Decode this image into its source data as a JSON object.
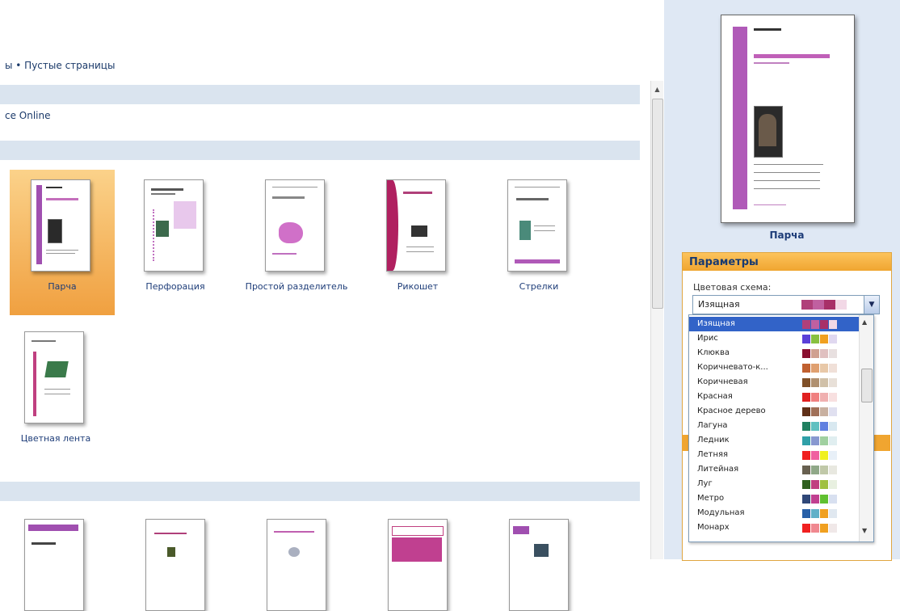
{
  "breadcrumb": "ы • Пустые страницы",
  "online_label": "ce Online",
  "templates": [
    {
      "label": "Парча",
      "selected": true
    },
    {
      "label": "Перфорация",
      "selected": false
    },
    {
      "label": "Простой разделитель",
      "selected": false
    },
    {
      "label": "Рикошет",
      "selected": false
    },
    {
      "label": "Стрелки",
      "selected": false
    },
    {
      "label": "Цветная лента",
      "selected": false
    }
  ],
  "preview": {
    "label": "Парча"
  },
  "params": {
    "title": "Параметры",
    "color_scheme_label": "Цветовая схема:",
    "selected_scheme": "Изящная",
    "selected_colors": [
      "#b0407a",
      "#c060a0",
      "#a83068",
      "#f2d8e6"
    ]
  },
  "scheme_options": [
    {
      "name": "Изящная",
      "colors": [
        "#b0407a",
        "#c060a0",
        "#a83068",
        "#f2d8e6"
      ],
      "highlighted": true
    },
    {
      "name": "Ирис",
      "colors": [
        "#5a40d8",
        "#88c040",
        "#f0a020",
        "#e0d8f0"
      ]
    },
    {
      "name": "Клюква",
      "colors": [
        "#8a1030",
        "#d0a090",
        "#e0c0c0",
        "#e8e0e0"
      ]
    },
    {
      "name": "Коричневато-к...",
      "colors": [
        "#c06030",
        "#e0a070",
        "#e8c8a8",
        "#f0e0d8"
      ]
    },
    {
      "name": "Коричневая",
      "colors": [
        "#805028",
        "#b09070",
        "#d0c0a8",
        "#e8e0d8"
      ]
    },
    {
      "name": "Красная",
      "colors": [
        "#e02020",
        "#f08080",
        "#f0b0b0",
        "#f8e0e0"
      ]
    },
    {
      "name": "Красное дерево",
      "colors": [
        "#603018",
        "#a07058",
        "#c8b0a0",
        "#e0e0f0"
      ]
    },
    {
      "name": "Лагуна",
      "colors": [
        "#208060",
        "#60c0c0",
        "#6080e0",
        "#d8e8f0"
      ]
    },
    {
      "name": "Ледник",
      "colors": [
        "#30a0a8",
        "#8898d0",
        "#a0d0a0",
        "#e0eef0"
      ]
    },
    {
      "name": "Летняя",
      "colors": [
        "#f02020",
        "#f060a0",
        "#f0f020",
        "#e8f0f8"
      ]
    },
    {
      "name": "Литейная",
      "colors": [
        "#686050",
        "#90a888",
        "#c0c8a8",
        "#e8e8e0"
      ]
    },
    {
      "name": "Луг",
      "colors": [
        "#306020",
        "#c04080",
        "#a0c040",
        "#e8f0e0"
      ]
    },
    {
      "name": "Метро",
      "colors": [
        "#304878",
        "#c04090",
        "#60c030",
        "#d8e0f0"
      ]
    },
    {
      "name": "Модульная",
      "colors": [
        "#2860a8",
        "#60b0c8",
        "#f0a020",
        "#e0e8f0"
      ]
    },
    {
      "name": "Монарх",
      "colors": [
        "#f02020",
        "#f08890",
        "#f0a020",
        "#f0e8e8"
      ]
    }
  ]
}
